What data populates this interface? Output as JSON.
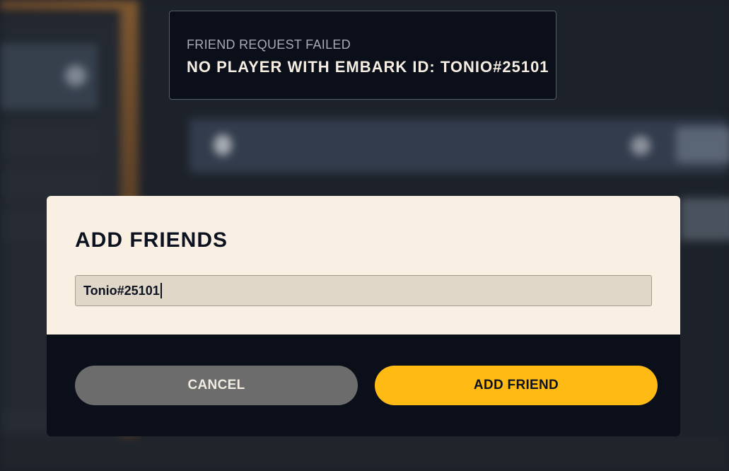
{
  "notification": {
    "title": "FRIEND REQUEST FAILED",
    "message": "NO PLAYER WITH EMBARK ID: TONIO#25101"
  },
  "dialog": {
    "title": "ADD FRIENDS",
    "input_value": "Tonio#25101",
    "cancel_label": "CANCEL",
    "add_label": "ADD FRIEND"
  },
  "colors": {
    "accent": "#ffbb14",
    "dialog_background": "#f9efe3",
    "footer_background": "#0b0f1a",
    "cancel_button": "#6c6c6c"
  }
}
